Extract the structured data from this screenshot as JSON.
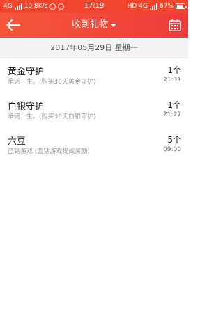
{
  "status_bar": {
    "network": "4G",
    "speed": "10.8K/s",
    "time": "17:19",
    "hd": "HD",
    "network_right": "4G",
    "battery": "67%"
  },
  "header": {
    "title": "收到礼物",
    "back_icon": "arrow-left-icon",
    "calendar_icon": "calendar-icon",
    "accent": "#f1462d"
  },
  "date_bar": {
    "date": "2017年05月29日  星期一"
  },
  "gifts": [
    {
      "name": "黄金守护",
      "desc": "承诺一生。(购买30天黄金守护)",
      "count": "1个",
      "time": "21:31"
    },
    {
      "name": "白银守护",
      "desc": "承诺一生。(购买30天白银守护)",
      "count": "1个",
      "time": "21:27"
    },
    {
      "name": "六豆",
      "desc": "蓝钻游戏 (蓝钻游戏提成奖励)",
      "count": "5个",
      "time": "09:00"
    }
  ]
}
